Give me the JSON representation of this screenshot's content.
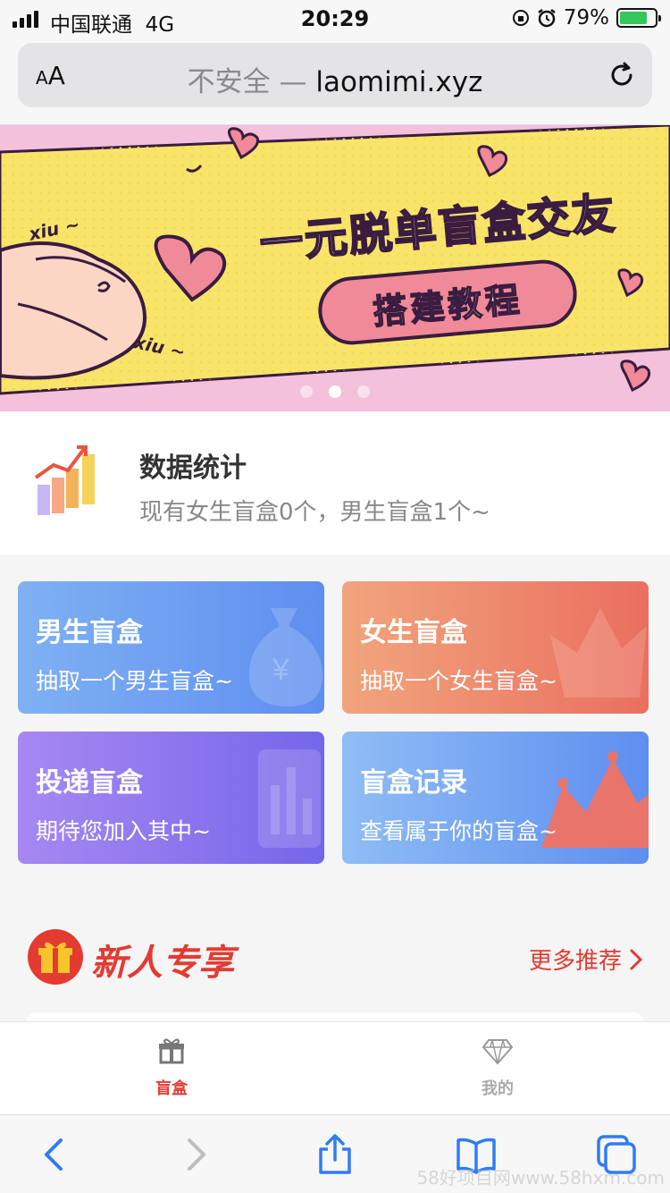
{
  "status": {
    "carrier": "中国联通",
    "network": "4G",
    "time": "20:29",
    "battery_pct": "79%",
    "battery_level": 0.79
  },
  "browser": {
    "aa_small": "A",
    "aa_large": "A",
    "insecure": "不安全 —",
    "host": "laomimi.xyz"
  },
  "banner": {
    "title": "一元脱单盲盒交友",
    "pill": "搭建教程",
    "xiu1": "xiu ~",
    "xiu2": "xiu ~",
    "slides": 3,
    "active_slide": 1
  },
  "stats": {
    "title": "数据统计",
    "desc": "现有女生盲盒0个，男生盲盒1个~"
  },
  "cards": {
    "boy": {
      "title": "男生盲盒",
      "sub": "抽取一个男生盲盒~"
    },
    "girl": {
      "title": "女生盲盒",
      "sub": "抽取一个女生盲盒~"
    },
    "post": {
      "title": "投递盲盒",
      "sub": "期待您加入其中~"
    },
    "record": {
      "title": "盲盒记录",
      "sub": "查看属于你的盲盒~"
    }
  },
  "newsec": {
    "title": "新人专享",
    "more": "更多推荐"
  },
  "tabs": {
    "box": "盲盒",
    "mine": "我的"
  },
  "watermark": "58好项目网www.58hxm.com",
  "colors": {
    "accent": "#e33b32",
    "boy_card": "#5e8ef0",
    "girl_card": "#ea6f5f",
    "post_card": "#7466ea"
  }
}
